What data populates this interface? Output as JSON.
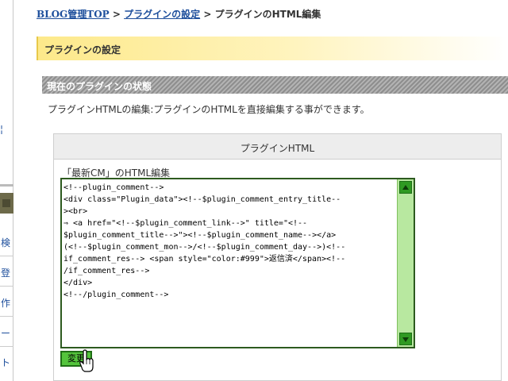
{
  "breadcrumb": {
    "home": "BLOG管理TOP",
    "sep1": ">",
    "plugin_settings": "プラグインの設定",
    "sep2": ">",
    "current": "プラグインのHTML編集"
  },
  "page_title": "プラグインの設定",
  "section_title": "現在のプラグインの状態",
  "description": "プラグインHTMLの編集:プラグインのHTMLを直接編集する事ができます。",
  "panel": {
    "header": "プラグインHTML",
    "edit_label": "「最新CM」のHTML編集",
    "code": "<!--plugin_comment-->\n<div class=\"Plugin_data\"><!--$plugin_comment_entry_title--\n><br>\n⇒ <a href=\"<!--$plugin_comment_link-->\" title=\"<!--\n$plugin_comment_title-->\"><!--$plugin_comment_name--></a>\n(<!--$plugin_comment_mon-->/<!--$plugin_comment_day-->)<!--\nif_comment_res--> <span style=\"color:#999\">返信済</span><!--\n/if_comment_res-->\n</div>\n<!--/plugin_comment-->",
    "submit_label": "変更"
  },
  "sidebar": {
    "items": [
      "検",
      "登",
      "作",
      "ー",
      "ト"
    ],
    "mark": "¦"
  },
  "colors": {
    "link": "#1e4f9c",
    "title_bar": "#fde98a",
    "scrollbar": "#b8e8a0",
    "button": "#54c43c"
  }
}
